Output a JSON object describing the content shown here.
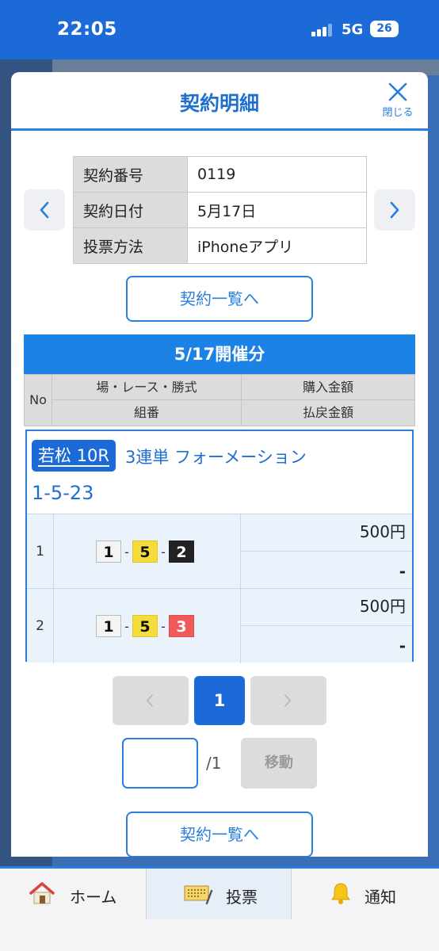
{
  "status_bar": {
    "time": "22:05",
    "network": "5G",
    "battery": "26"
  },
  "modal": {
    "title": "契約明細",
    "close_label": "閉じる",
    "info_rows": [
      {
        "key": "契約番号",
        "value": "0119"
      },
      {
        "key": "契約日付",
        "value": "5月17日"
      },
      {
        "key": "投票方法",
        "value": "iPhoneアプリ"
      }
    ],
    "list_button_label": "契約一覧へ",
    "section_title": "5/17開催分",
    "table_header": {
      "no": "No",
      "race_col": "場・レース・勝式",
      "combo_col": "組番",
      "purchase_col": "購入金額",
      "payout_col": "払戻金額"
    },
    "bet": {
      "race": "若松 10R",
      "bet_type": "3連単 フォーメーション",
      "combination": "1-5-23",
      "rows": [
        {
          "no": "1",
          "boats": [
            "1",
            "5",
            "2"
          ],
          "amount": "500円",
          "payout": "-"
        },
        {
          "no": "2",
          "boats": [
            "1",
            "5",
            "3"
          ],
          "amount": "500円",
          "payout": "-"
        }
      ]
    },
    "pagination": {
      "current": "1",
      "total": "/1",
      "move_label": "移動",
      "input_value": ""
    }
  },
  "tabbar": {
    "home_label": "ホーム",
    "bet_label": "投票",
    "notice_label": "通知"
  },
  "colors": {
    "accent": "#1c6ad8",
    "boat1": "#f4f4f4",
    "boat2": "#222222",
    "boat3": "#ef5a5a",
    "boat5": "#f4dc3c"
  }
}
